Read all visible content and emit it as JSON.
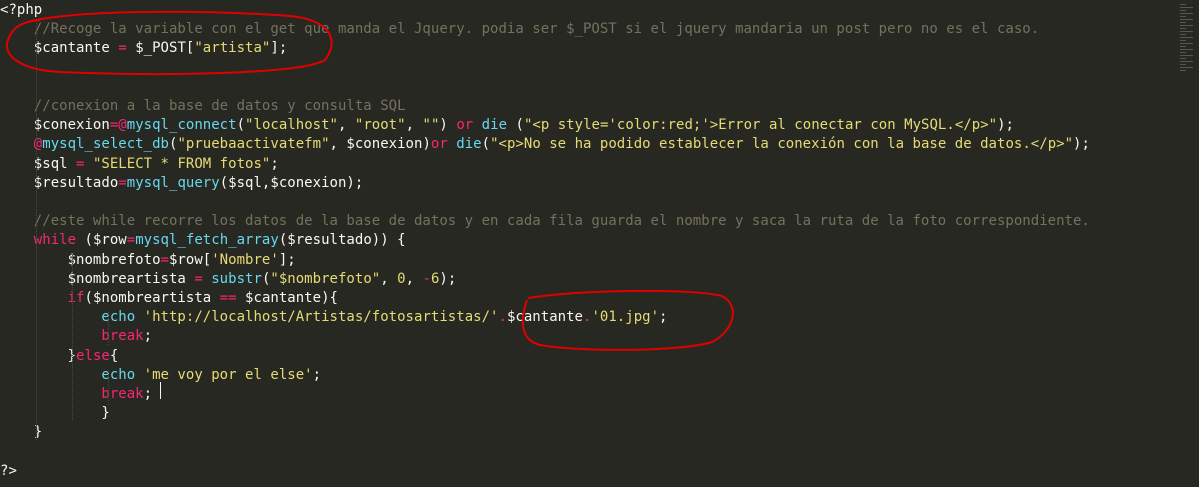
{
  "editor": {
    "lines": [
      {
        "segs": [
          [
            "pl",
            "<?php"
          ]
        ]
      },
      {
        "segs": [
          [
            "cmt",
            "    //Recoge la variable con el get que manda el Jquery. podia ser $_POST si el jquery mandaria un post pero no es el caso."
          ]
        ]
      },
      {
        "segs": [
          [
            "var",
            "    $cantante "
          ],
          [
            "op",
            "="
          ],
          [
            "var",
            " $_POST["
          ],
          [
            "str",
            "\"artista\""
          ],
          [
            "var",
            "];"
          ]
        ]
      },
      {
        "segs": []
      },
      {
        "segs": []
      },
      {
        "segs": [
          [
            "cmt",
            "    //conexion a la base de datos y consulta SQL"
          ]
        ]
      },
      {
        "segs": [
          [
            "var",
            "    $conexion"
          ],
          [
            "op",
            "=@"
          ],
          [
            "fn",
            "mysql_connect"
          ],
          [
            "var",
            "("
          ],
          [
            "str",
            "\"localhost\""
          ],
          [
            "var",
            ", "
          ],
          [
            "str",
            "\"root\""
          ],
          [
            "var",
            ", "
          ],
          [
            "str",
            "\"\""
          ],
          [
            "var",
            ") "
          ],
          [
            "kw",
            "or"
          ],
          [
            "var",
            " "
          ],
          [
            "fn",
            "die"
          ],
          [
            "var",
            " ("
          ],
          [
            "str",
            "\"<p style='color:red;'>Error al conectar con MySQL.</p>\""
          ],
          [
            "var",
            ");"
          ]
        ]
      },
      {
        "segs": [
          [
            "op",
            "    @"
          ],
          [
            "fn",
            "mysql_select_db"
          ],
          [
            "var",
            "("
          ],
          [
            "str",
            "\"pruebaactivatefm\""
          ],
          [
            "var",
            ", $conexion)"
          ],
          [
            "kw",
            "or"
          ],
          [
            "var",
            " "
          ],
          [
            "fn",
            "die"
          ],
          [
            "var",
            "("
          ],
          [
            "str",
            "\"<p>No se ha podido establecer la conexión con la base de datos.</p>\""
          ],
          [
            "var",
            ");"
          ]
        ]
      },
      {
        "segs": [
          [
            "var",
            "    $sql "
          ],
          [
            "op",
            "="
          ],
          [
            "var",
            " "
          ],
          [
            "str",
            "\"SELECT * FROM fotos\""
          ],
          [
            "var",
            ";"
          ]
        ]
      },
      {
        "segs": [
          [
            "var",
            "    $resultado"
          ],
          [
            "op",
            "="
          ],
          [
            "fn",
            "mysql_query"
          ],
          [
            "var",
            "($sql,$conexion);"
          ]
        ]
      },
      {
        "segs": []
      },
      {
        "segs": [
          [
            "cmt",
            "    //este while recorre los datos de la base de datos y en cada fila guarda el nombre y saca la ruta de la foto correspondiente."
          ]
        ]
      },
      {
        "segs": [
          [
            "kw",
            "    while"
          ],
          [
            "var",
            " ($row"
          ],
          [
            "op",
            "="
          ],
          [
            "fn",
            "mysql_fetch_array"
          ],
          [
            "var",
            "($resultado)) {"
          ]
        ]
      },
      {
        "segs": [
          [
            "var",
            "        $nombrefoto"
          ],
          [
            "op",
            "="
          ],
          [
            "var",
            "$row["
          ],
          [
            "str",
            "'Nombre'"
          ],
          [
            "var",
            "];"
          ]
        ]
      },
      {
        "segs": [
          [
            "var",
            "        $nombreartista "
          ],
          [
            "op",
            "="
          ],
          [
            "var",
            " "
          ],
          [
            "fn",
            "substr"
          ],
          [
            "var",
            "("
          ],
          [
            "str",
            "\"$nombrefoto\""
          ],
          [
            "var",
            ", "
          ],
          [
            "str",
            "0"
          ],
          [
            "var",
            ", "
          ],
          [
            "op",
            "-"
          ],
          [
            "str",
            "6"
          ],
          [
            "var",
            ");"
          ]
        ]
      },
      {
        "segs": [
          [
            "kw",
            "        if"
          ],
          [
            "var",
            "($nombreartista "
          ],
          [
            "op",
            "=="
          ],
          [
            "var",
            " $cantante){"
          ]
        ]
      },
      {
        "segs": [
          [
            "fn",
            "            echo"
          ],
          [
            "var",
            " "
          ],
          [
            "str",
            "'http://localhost/Artistas/fotosartistas/'"
          ],
          [
            "op",
            "."
          ],
          [
            "var",
            "$cantante"
          ],
          [
            "op",
            "."
          ],
          [
            "str",
            "'01.jpg'"
          ],
          [
            "var",
            ";"
          ]
        ]
      },
      {
        "segs": [
          [
            "kw",
            "            break"
          ],
          [
            "var",
            ";"
          ]
        ]
      },
      {
        "segs": [
          [
            "var",
            "        }"
          ],
          [
            "kw",
            "else"
          ],
          [
            "var",
            "{"
          ]
        ]
      },
      {
        "segs": [
          [
            "fn",
            "            echo"
          ],
          [
            "var",
            " "
          ],
          [
            "str",
            "'me voy por el else'"
          ],
          [
            "var",
            ";"
          ]
        ]
      },
      {
        "segs": [
          [
            "kw",
            "            break"
          ],
          [
            "var",
            ";"
          ]
        ]
      },
      {
        "segs": [
          [
            "var",
            "            }"
          ]
        ]
      },
      {
        "segs": [
          [
            "var",
            "    }"
          ]
        ]
      },
      {
        "segs": []
      },
      {
        "segs": [
          [
            "pl",
            "?>"
          ]
        ]
      }
    ]
  },
  "colors": {
    "background": "#272822",
    "comment": "#75715e",
    "keyword": "#f92672",
    "string": "#e6db74",
    "function": "#66d9ef",
    "plain": "#f8f8f2",
    "annotation": "#e00000"
  }
}
